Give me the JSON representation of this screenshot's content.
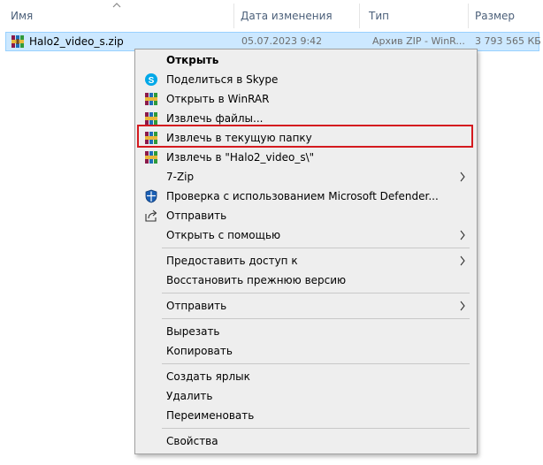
{
  "columns": {
    "name": "Имя",
    "date": "Дата изменения",
    "type": "Тип",
    "size": "Размер"
  },
  "file": {
    "name": "Halo2_video_s.zip",
    "date": "05.07.2023 9:42",
    "type": "Архив ZIP - WinR...",
    "size": "3 793 565 КБ",
    "icon": "winrar-archive-icon"
  },
  "menu": {
    "open": "Открыть",
    "share_skype": "Поделиться в Skype",
    "open_winrar": "Открыть в WinRAR",
    "extract_files": "Извлечь файлы...",
    "extract_here": "Извлечь в текущую папку",
    "extract_to": "Извлечь в \"Halo2_video_s\\\"",
    "seven_zip": "7-Zip",
    "defender": "Проверка с использованием Microsoft Defender...",
    "share": "Отправить",
    "open_with": "Открыть с помощью",
    "give_access": "Предоставить доступ к",
    "restore": "Восстановить прежнюю версию",
    "send_to": "Отправить",
    "cut": "Вырезать",
    "copy": "Копировать",
    "shortcut": "Создать ярлык",
    "delete": "Удалить",
    "rename": "Переименовать",
    "properties": "Свойства"
  },
  "colors": {
    "selection_bg": "#cce8ff",
    "highlight_border": "#d41a1f",
    "menu_bg": "#eeeeee"
  }
}
